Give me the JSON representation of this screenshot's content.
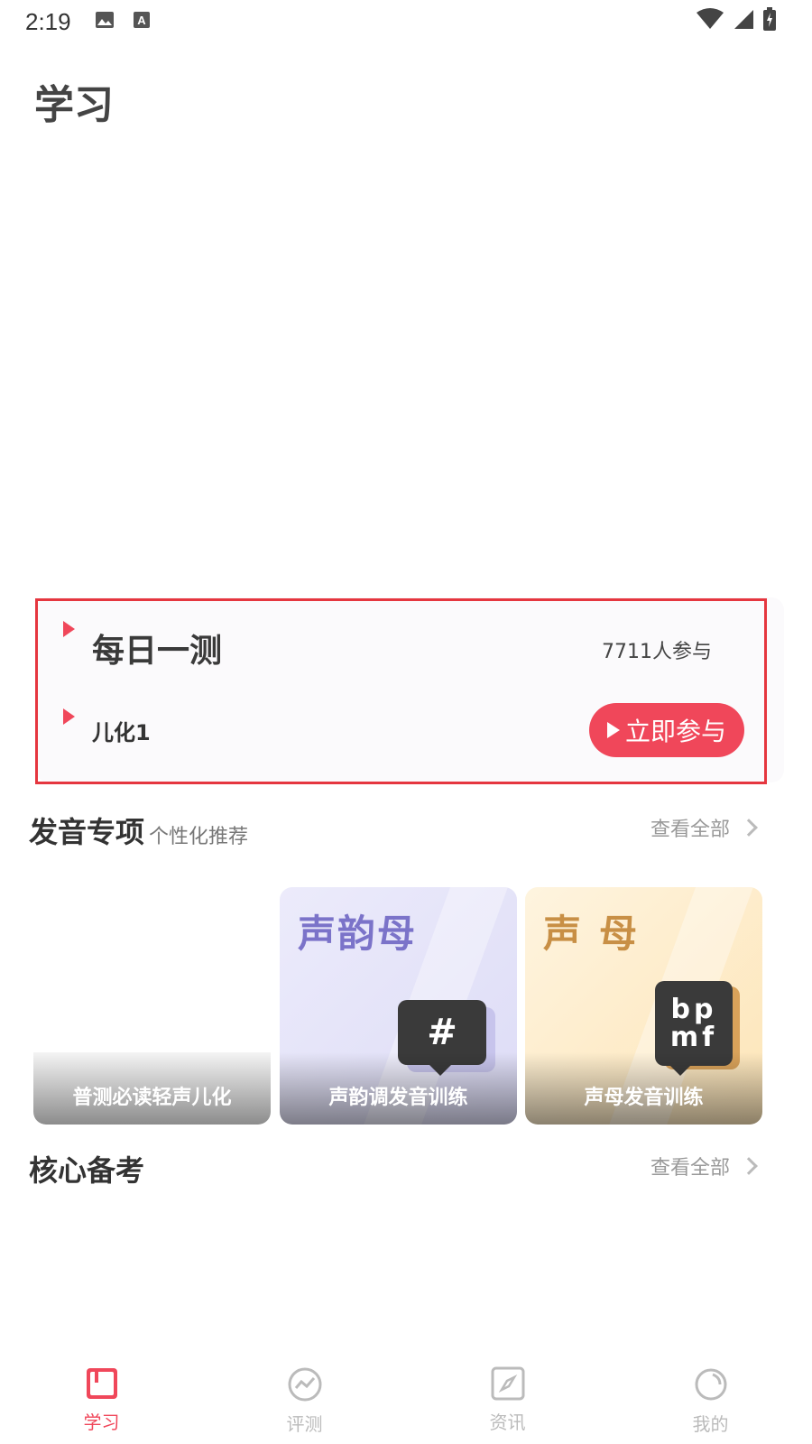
{
  "status_bar": {
    "time": "2:19"
  },
  "page": {
    "title": "学习"
  },
  "daily_test": {
    "title": "每日一测",
    "participants": "7711人参与",
    "topic": "儿化1",
    "join_label": "立即参与"
  },
  "pronunciation": {
    "title": "发音专项",
    "subtitle": "个性化推荐",
    "view_all": "查看全部",
    "cards": [
      {
        "label": "普测必读轻声儿化"
      },
      {
        "big_text": "声韵母",
        "badge": "#",
        "label": "声韵调发音训练"
      },
      {
        "big_text": "声母",
        "badge_line1": "bp",
        "badge_line2": "mf",
        "label": "声母发音训练"
      }
    ]
  },
  "core_prep": {
    "title": "核心备考",
    "view_all": "查看全部"
  },
  "bottom_nav": {
    "items": [
      {
        "label": "学习",
        "icon": "study-icon",
        "active": true
      },
      {
        "label": "评测",
        "icon": "assessment-icon",
        "active": false
      },
      {
        "label": "资讯",
        "icon": "compass-icon",
        "active": false
      },
      {
        "label": "我的",
        "icon": "profile-icon",
        "active": false
      }
    ]
  },
  "colors": {
    "accent": "#f0475a",
    "highlight": "#e5363f"
  }
}
